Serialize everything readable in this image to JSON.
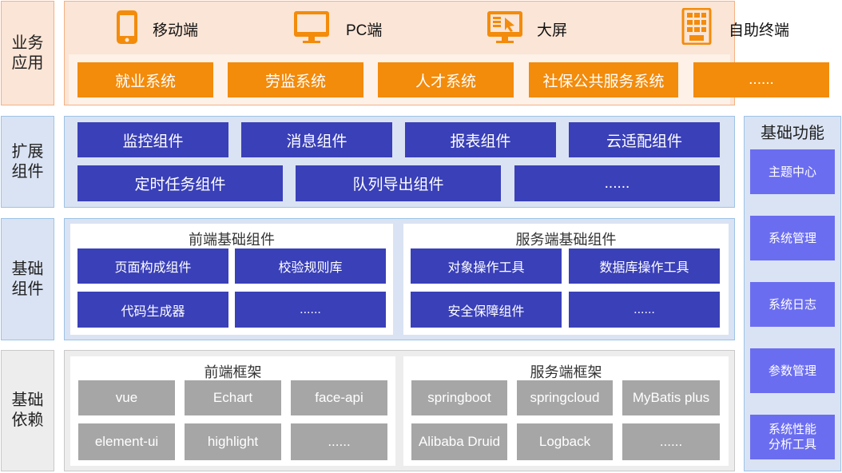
{
  "layers": {
    "business": "业务\n应用",
    "extension": "扩展\n组件",
    "basic": "基础\n组件",
    "dependency": "基础\n依赖"
  },
  "clients": [
    {
      "label": "移动端",
      "icon": "mobile-phone-icon"
    },
    {
      "label": "PC端",
      "icon": "desktop-monitor-icon"
    },
    {
      "label": "大屏",
      "icon": "large-screen-icon"
    },
    {
      "label": "自助终端",
      "icon": "kiosk-terminal-icon"
    }
  ],
  "systems": [
    "就业系统",
    "劳监系统",
    "人才系统",
    "社保公共服务系统",
    "......"
  ],
  "extension_components": [
    "监控组件",
    "消息组件",
    "报表组件",
    "云适配组件",
    "定时任务组件",
    "队列导出组件",
    "......"
  ],
  "frontend_basic": {
    "title": "前端基础组件",
    "items": [
      "页面构成组件",
      "校验规则库",
      "代码生成器",
      "......"
    ]
  },
  "server_basic": {
    "title": "服务端基础组件",
    "items": [
      "对象操作工具",
      "数据库操作工具",
      "安全保障组件",
      "......"
    ]
  },
  "frontend_framework": {
    "title": "前端框架",
    "items": [
      "vue",
      "Echart",
      "face-api",
      "element-ui",
      "highlight",
      "......"
    ]
  },
  "server_framework": {
    "title": "服务端框架",
    "items": [
      "springboot",
      "springcloud",
      "MyBatis plus",
      "Alibaba Druid",
      "Logback",
      "......"
    ]
  },
  "base_functions": {
    "title": "基础功能",
    "items": [
      "主题中心",
      "系统管理",
      "系统日志",
      "参数管理",
      "系统性能\n分析工具"
    ]
  },
  "colors": {
    "orange": "#f38b0b",
    "blue": "#3a40b8",
    "purple": "#6b6df0",
    "gray": "#a6a6a6"
  }
}
